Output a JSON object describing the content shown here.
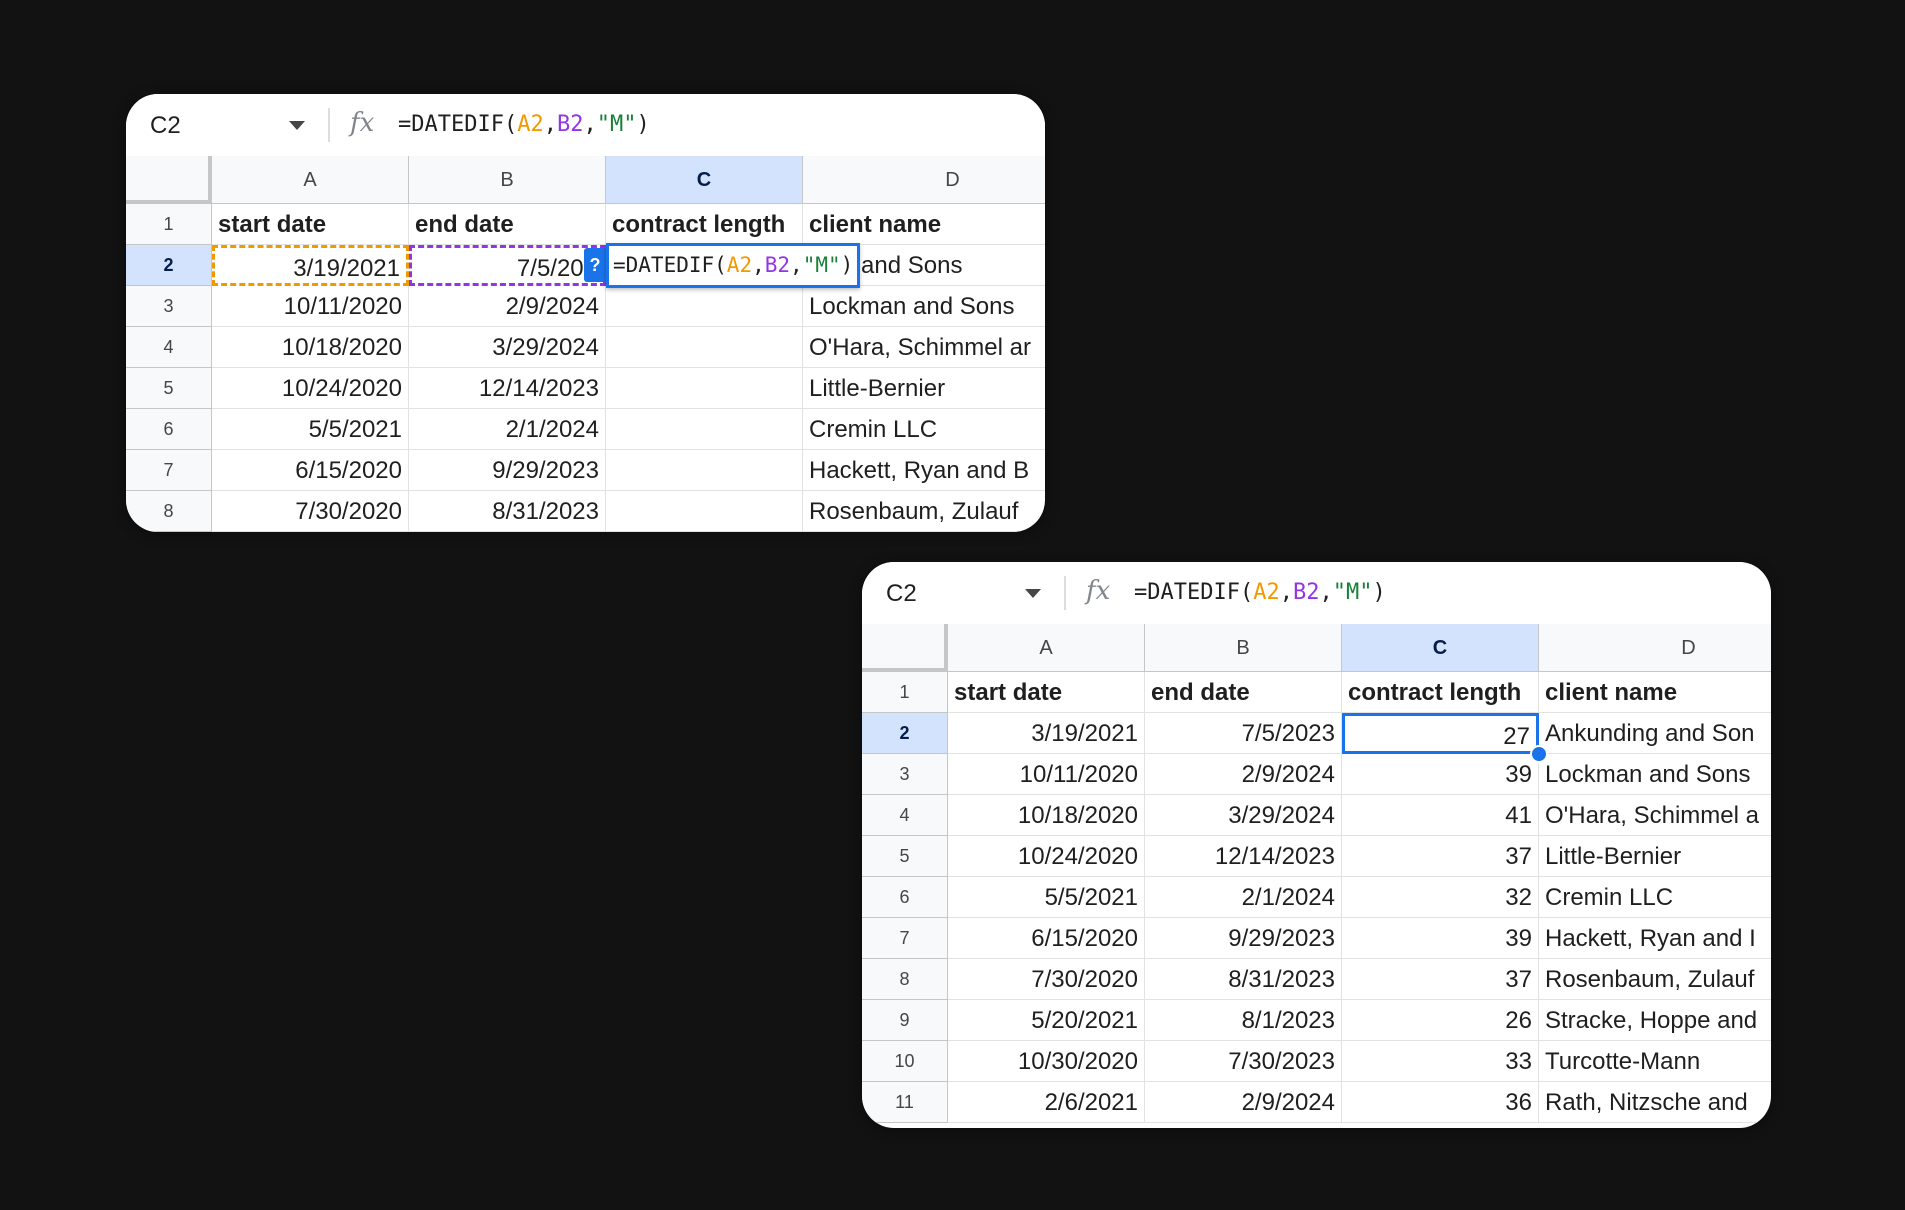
{
  "before": {
    "name_box": "C2",
    "formula": {
      "prefix": "=DATEDIF(",
      "arg1": "A2",
      "sep1": ",",
      "arg2": "B2",
      "sep2": ",",
      "arg3": "\"M\"",
      "suffix": ")"
    },
    "editor_formula": {
      "prefix": "=DATEDIF(",
      "arg1": "A2",
      "sep1": ",",
      "arg2": "B2",
      "sep2": ",",
      "arg3": "\"M\"",
      "suffix": ")"
    },
    "help_icon_label": "?",
    "columns": [
      "A",
      "B",
      "C",
      "D"
    ],
    "header_row": {
      "num": "1",
      "cells": [
        "start date",
        "end date",
        "contract length",
        "client name"
      ]
    },
    "rows": [
      {
        "num": "2",
        "cells": [
          "3/19/2021",
          "7/5/202",
          "",
          "ding and Sons"
        ]
      },
      {
        "num": "3",
        "cells": [
          "10/11/2020",
          "2/9/2024",
          "",
          "Lockman and Sons"
        ]
      },
      {
        "num": "4",
        "cells": [
          "10/18/2020",
          "3/29/2024",
          "",
          "O'Hara, Schimmel ar"
        ]
      },
      {
        "num": "5",
        "cells": [
          "10/24/2020",
          "12/14/2023",
          "",
          "Little-Bernier"
        ]
      },
      {
        "num": "6",
        "cells": [
          "5/5/2021",
          "2/1/2024",
          "",
          "Cremin LLC"
        ]
      },
      {
        "num": "7",
        "cells": [
          "6/15/2020",
          "9/29/2023",
          "",
          "Hackett, Ryan and B"
        ]
      },
      {
        "num": "8",
        "cells": [
          "7/30/2020",
          "8/31/2023",
          "",
          "Rosenbaum, Zulauf"
        ]
      }
    ]
  },
  "after": {
    "name_box": "C2",
    "formula": {
      "prefix": "=DATEDIF(",
      "arg1": "A2",
      "sep1": ",",
      "arg2": "B2",
      "sep2": ",",
      "arg3": "\"M\"",
      "suffix": ")"
    },
    "columns": [
      "A",
      "B",
      "C",
      "D"
    ],
    "header_row": {
      "num": "1",
      "cells": [
        "start date",
        "end date",
        "contract length",
        "client name"
      ]
    },
    "rows": [
      {
        "num": "2",
        "cells": [
          "3/19/2021",
          "7/5/2023",
          "27",
          "Ankunding and Son"
        ]
      },
      {
        "num": "3",
        "cells": [
          "10/11/2020",
          "2/9/2024",
          "39",
          "Lockman and Sons"
        ]
      },
      {
        "num": "4",
        "cells": [
          "10/18/2020",
          "3/29/2024",
          "41",
          "O'Hara, Schimmel a"
        ]
      },
      {
        "num": "5",
        "cells": [
          "10/24/2020",
          "12/14/2023",
          "37",
          "Little-Bernier"
        ]
      },
      {
        "num": "6",
        "cells": [
          "5/5/2021",
          "2/1/2024",
          "32",
          "Cremin LLC"
        ]
      },
      {
        "num": "7",
        "cells": [
          "6/15/2020",
          "9/29/2023",
          "39",
          "Hackett, Ryan and I"
        ]
      },
      {
        "num": "8",
        "cells": [
          "7/30/2020",
          "8/31/2023",
          "37",
          "Rosenbaum, Zulauf"
        ]
      },
      {
        "num": "9",
        "cells": [
          "5/20/2021",
          "8/1/2023",
          "26",
          "Stracke, Hoppe and"
        ]
      },
      {
        "num": "10",
        "cells": [
          "10/30/2020",
          "7/30/2023",
          "33",
          "Turcotte-Mann"
        ]
      },
      {
        "num": "11",
        "cells": [
          "2/6/2021",
          "2/9/2024",
          "36",
          "Rath, Nitzsche and"
        ]
      }
    ]
  }
}
